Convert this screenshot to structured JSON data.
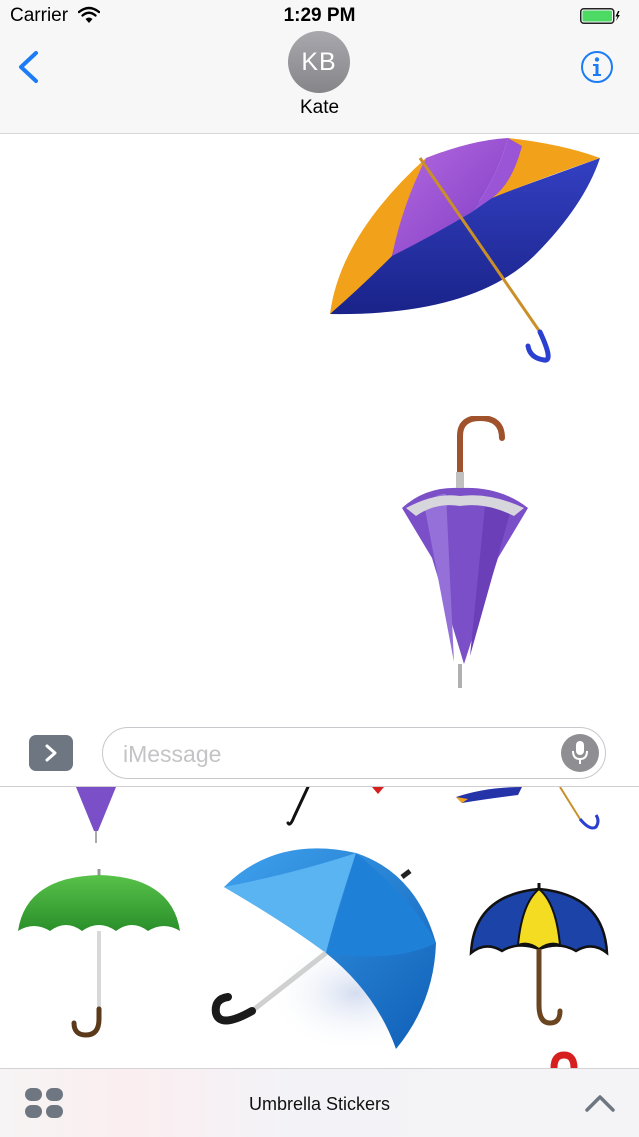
{
  "status_bar": {
    "carrier": "Carrier",
    "time": "1:29 PM"
  },
  "nav": {
    "avatar_initials": "KB",
    "contact_name": "Kate"
  },
  "input": {
    "placeholder": "iMessage"
  },
  "drawer": {
    "title": "Umbrella Stickers"
  },
  "colors": {
    "ios_blue": "#1b7cf5",
    "purple": "#7b4fc7",
    "orange": "#f2a21a",
    "navy": "#1f2e9e",
    "green": "#3aa63a",
    "sky_blue": "#1f80d8",
    "yellow": "#f3dc22"
  },
  "icons": [
    "wifi-icon",
    "battery-icon",
    "back-icon",
    "info-icon",
    "expand-icon",
    "microphone-icon",
    "apps-icon",
    "chevron-up-icon"
  ]
}
